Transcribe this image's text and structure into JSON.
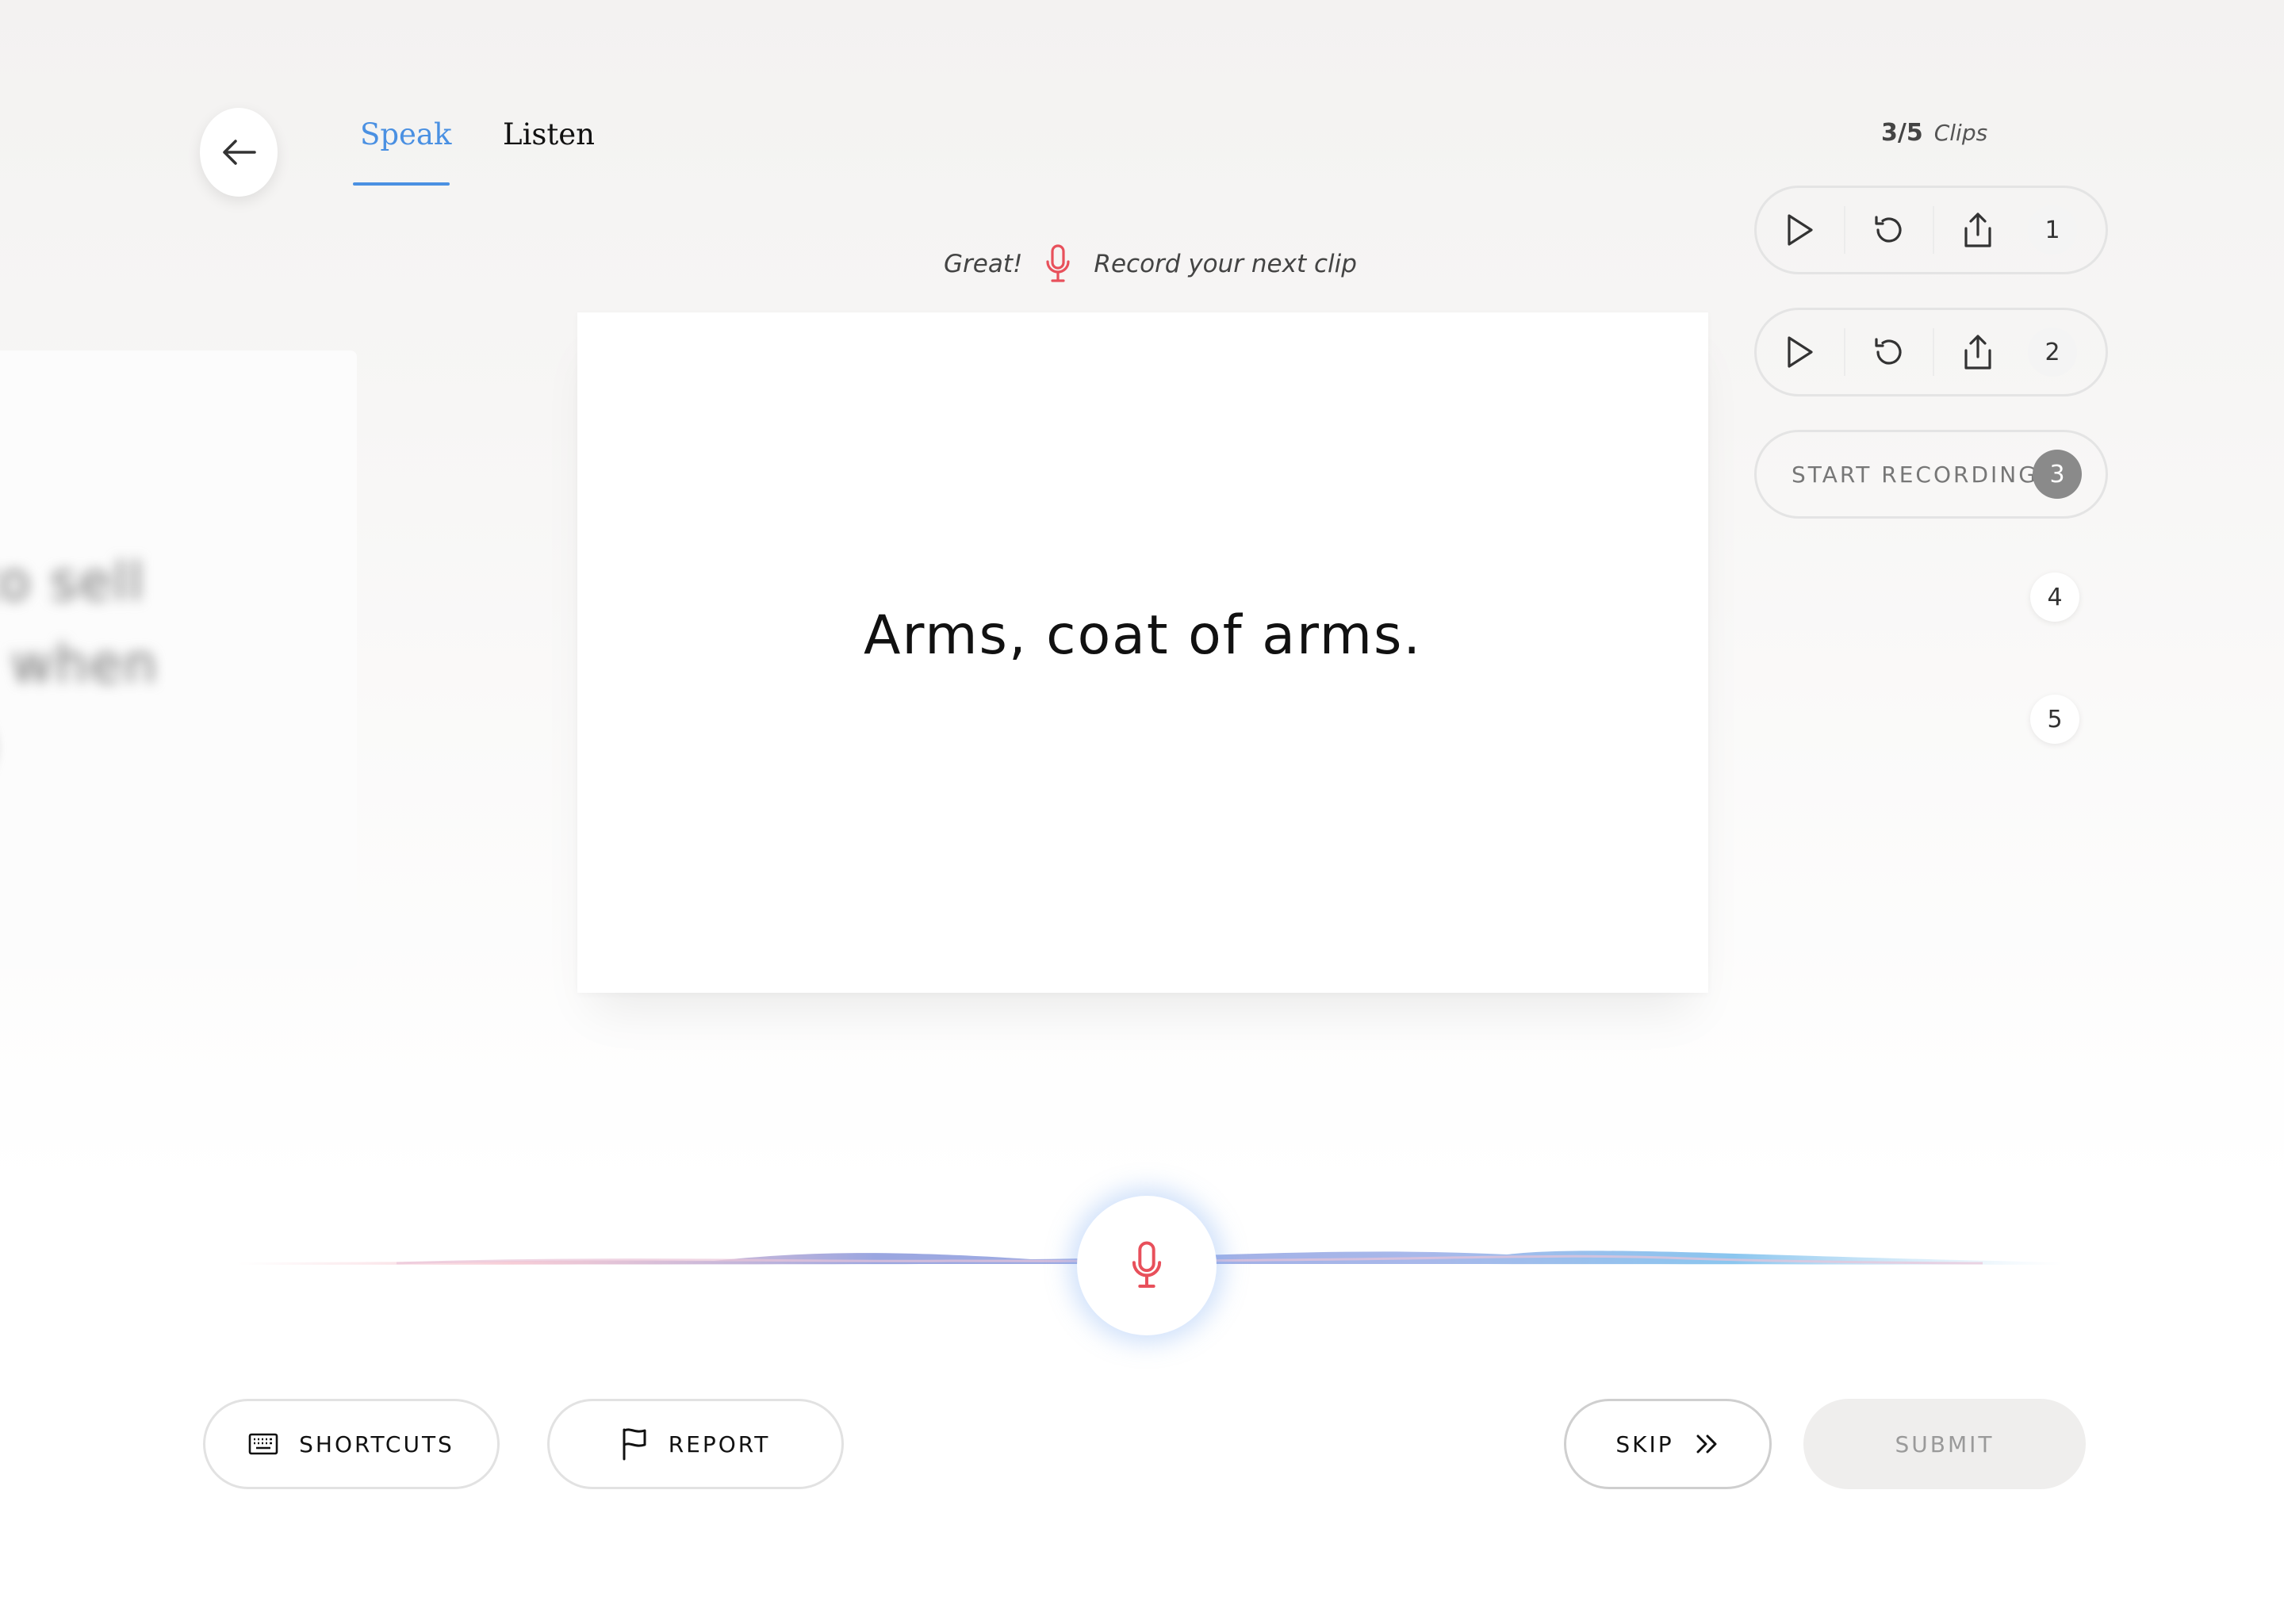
{
  "tabs": [
    {
      "label": "Speak",
      "active": true
    },
    {
      "label": "Listen",
      "active": false
    }
  ],
  "clips": {
    "count": "3/5",
    "label": "Clips"
  },
  "status": {
    "prefix": "Great!",
    "message": "Record your next clip"
  },
  "ghost_card": {
    "lines": [
      "to sell",
      "l when",
      ")"
    ]
  },
  "prompt": {
    "sentence": "Arms, coat of arms."
  },
  "clip_list": [
    {
      "number": "1",
      "state": "recorded"
    },
    {
      "number": "2",
      "state": "recorded"
    },
    {
      "number": "3",
      "state": "current",
      "action_label": "START RECORDING"
    },
    {
      "number": "4",
      "state": "empty"
    },
    {
      "number": "5",
      "state": "empty"
    }
  ],
  "buttons": {
    "shortcuts": "SHORTCUTS",
    "report": "REPORT",
    "skip": "SKIP",
    "submit": "SUBMIT"
  },
  "colors": {
    "accent_blue": "#4a90e2",
    "mic_red": "#e8505b",
    "submit_disabled_bg": "#efeeed"
  },
  "icons": {
    "back": "arrow-left-icon",
    "status": "microphone-icon",
    "play": "play-icon",
    "rerecord": "rerecord-icon",
    "share": "share-icon",
    "record": "microphone-icon",
    "shortcuts": "keyboard-icon",
    "report": "flag-icon",
    "skip": "double-chevron-right-icon"
  }
}
